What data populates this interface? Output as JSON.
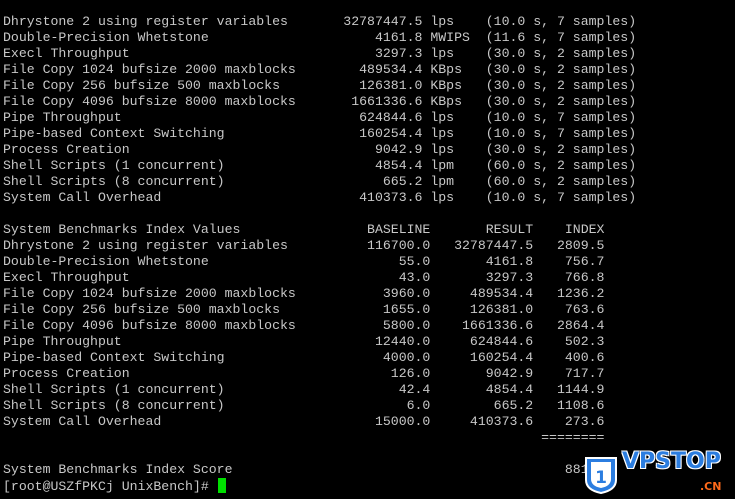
{
  "terminal": {
    "fg_color": "#c8c8c8",
    "bg_color": "#000000",
    "cursor_color": "#00e000",
    "results": [
      {
        "name": "Dhrystone 2 using register variables",
        "value": "32787447.5",
        "unit": "lps",
        "detail": "(10.0 s, 7 samples)"
      },
      {
        "name": "Double-Precision Whetstone",
        "value": "4161.8",
        "unit": "MWIPS",
        "detail": "(11.6 s, 7 samples)"
      },
      {
        "name": "Execl Throughput",
        "value": "3297.3",
        "unit": "lps",
        "detail": "(30.0 s, 2 samples)"
      },
      {
        "name": "File Copy 1024 bufsize 2000 maxblocks",
        "value": "489534.4",
        "unit": "KBps",
        "detail": "(30.0 s, 2 samples)"
      },
      {
        "name": "File Copy 256 bufsize 500 maxblocks",
        "value": "126381.0",
        "unit": "KBps",
        "detail": "(30.0 s, 2 samples)"
      },
      {
        "name": "File Copy 4096 bufsize 8000 maxblocks",
        "value": "1661336.6",
        "unit": "KBps",
        "detail": "(30.0 s, 2 samples)"
      },
      {
        "name": "Pipe Throughput",
        "value": "624844.6",
        "unit": "lps",
        "detail": "(10.0 s, 7 samples)"
      },
      {
        "name": "Pipe-based Context Switching",
        "value": "160254.4",
        "unit": "lps",
        "detail": "(10.0 s, 7 samples)"
      },
      {
        "name": "Process Creation",
        "value": "9042.9",
        "unit": "lps",
        "detail": "(30.0 s, 2 samples)"
      },
      {
        "name": "Shell Scripts (1 concurrent)",
        "value": "4854.4",
        "unit": "lpm",
        "detail": "(60.0 s, 2 samples)"
      },
      {
        "name": "Shell Scripts (8 concurrent)",
        "value": "665.2",
        "unit": "lpm",
        "detail": "(60.0 s, 2 samples)"
      },
      {
        "name": "System Call Overhead",
        "value": "410373.6",
        "unit": "lps",
        "detail": "(10.0 s, 7 samples)"
      }
    ],
    "index_header": {
      "title": "System Benchmarks Index Values",
      "col_baseline": "BASELINE",
      "col_result": "RESULT",
      "col_index": "INDEX"
    },
    "index_rows": [
      {
        "name": "Dhrystone 2 using register variables",
        "baseline": "116700.0",
        "result": "32787447.5",
        "index": "2809.5"
      },
      {
        "name": "Double-Precision Whetstone",
        "baseline": "55.0",
        "result": "4161.8",
        "index": "756.7"
      },
      {
        "name": "Execl Throughput",
        "baseline": "43.0",
        "result": "3297.3",
        "index": "766.8"
      },
      {
        "name": "File Copy 1024 bufsize 2000 maxblocks",
        "baseline": "3960.0",
        "result": "489534.4",
        "index": "1236.2"
      },
      {
        "name": "File Copy 256 bufsize 500 maxblocks",
        "baseline": "1655.0",
        "result": "126381.0",
        "index": "763.6"
      },
      {
        "name": "File Copy 4096 bufsize 8000 maxblocks",
        "baseline": "5800.0",
        "result": "1661336.6",
        "index": "2864.4"
      },
      {
        "name": "Pipe Throughput",
        "baseline": "12440.0",
        "result": "624844.6",
        "index": "502.3"
      },
      {
        "name": "Pipe-based Context Switching",
        "baseline": "4000.0",
        "result": "160254.4",
        "index": "400.6"
      },
      {
        "name": "Process Creation",
        "baseline": "126.0",
        "result": "9042.9",
        "index": "717.7"
      },
      {
        "name": "Shell Scripts (1 concurrent)",
        "baseline": "42.4",
        "result": "4854.4",
        "index": "1144.9"
      },
      {
        "name": "Shell Scripts (8 concurrent)",
        "baseline": "6.0",
        "result": "665.2",
        "index": "1108.6"
      },
      {
        "name": "System Call Overhead",
        "baseline": "15000.0",
        "result": "410373.6",
        "index": "273.6"
      }
    ],
    "separator": "========",
    "score_label": "System Benchmarks Index Score",
    "score_value": "881.8",
    "prompt": "[root@USZfPKCj UnixBench]#"
  },
  "watermark": {
    "badge_number": "1",
    "brand": "VPSTOP",
    "suffix": ".CN",
    "brand_color": "#2b7de0",
    "suffix_color": "#ff6a1a"
  }
}
